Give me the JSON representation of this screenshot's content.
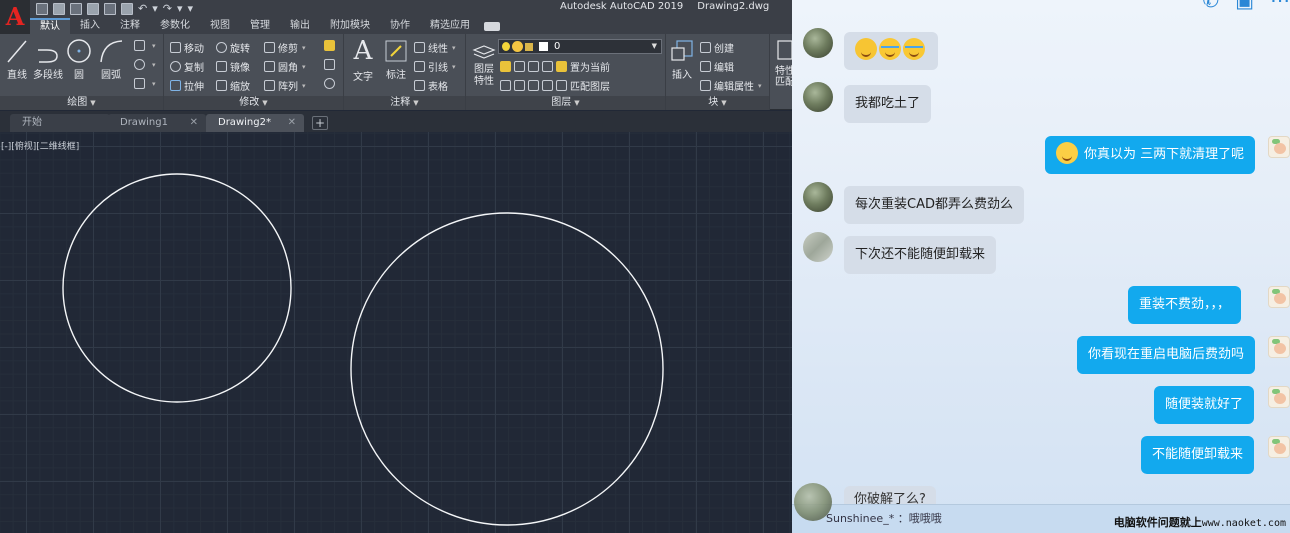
{
  "cad": {
    "app_title": "Autodesk AutoCAD 2019",
    "doc_title": "Drawing2.dwg",
    "ribbon_tabs": [
      "默认",
      "插入",
      "注释",
      "参数化",
      "视图",
      "管理",
      "输出",
      "附加模块",
      "协作",
      "精选应用"
    ],
    "panels": {
      "draw": {
        "label": "绘图",
        "big": [
          "直线",
          "多段线",
          "圆",
          "圆弧"
        ]
      },
      "modify": {
        "label": "修改",
        "rows": [
          [
            "移动",
            "旋转",
            "修剪"
          ],
          [
            "复制",
            "镜像",
            "圆角"
          ],
          [
            "拉伸",
            "缩放",
            "阵列"
          ]
        ]
      },
      "annotation": {
        "label": "注释",
        "big": [
          "文字",
          "标注"
        ],
        "rows": [
          "线性",
          "引线",
          "表格"
        ]
      },
      "layers": {
        "label": "图层",
        "big": "图层\n特性",
        "current_layer": "0",
        "row2": "置为当前",
        "row3": "匹配图层"
      },
      "block": {
        "label": "块",
        "big": "插入",
        "rows": [
          "创建",
          "编辑",
          "编辑属性"
        ]
      },
      "properties": {
        "big_line1": "特性",
        "big_line2": "匹配"
      }
    },
    "doc_tabs": [
      {
        "label": "开始",
        "active": false
      },
      {
        "label": "Drawing1",
        "active": false
      },
      {
        "label": "Drawing2*",
        "active": true
      }
    ],
    "viewport_label": "[-][俯视][二维线框]",
    "colors": {
      "accent": "#5d9ad4",
      "background": "#212836",
      "logo": "#e52421"
    }
  },
  "chat": {
    "messages": [
      {
        "side": "in",
        "avatar": "other",
        "emojis": [
          "thinking-emoji",
          "laughing-tears-emoji",
          "laughing-tears-emoji"
        ],
        "text": ""
      },
      {
        "side": "in",
        "avatar": "other",
        "text": "我都吃土了"
      },
      {
        "side": "out",
        "avatar": "me",
        "emojis": [
          "smirk-emoji"
        ],
        "text": "你真以为 三两下就清理了呢"
      },
      {
        "side": "in",
        "avatar": "other",
        "text": "每次重装CAD都弄么费劲么"
      },
      {
        "side": "in",
        "avatar": "other2",
        "text": "下次还不能随便卸载来"
      },
      {
        "side": "out",
        "avatar": "me",
        "text": "重装不费劲，，，"
      },
      {
        "side": "out",
        "avatar": "me",
        "text": "你看现在重启电脑后费劲吗"
      },
      {
        "side": "out",
        "avatar": "me",
        "text": "随便装就好了"
      },
      {
        "side": "out",
        "avatar": "me",
        "text": "不能随便卸载来"
      }
    ],
    "partial_message": "你破解了么?",
    "footer_name": "Sunshinee_* ：哦哦哦",
    "watermark": "电脑软件问题就上",
    "watermark_url": "www.naoket.com",
    "colors": {
      "out_bubble": "#12a9ee",
      "in_bubble": "#d5dde8"
    }
  }
}
